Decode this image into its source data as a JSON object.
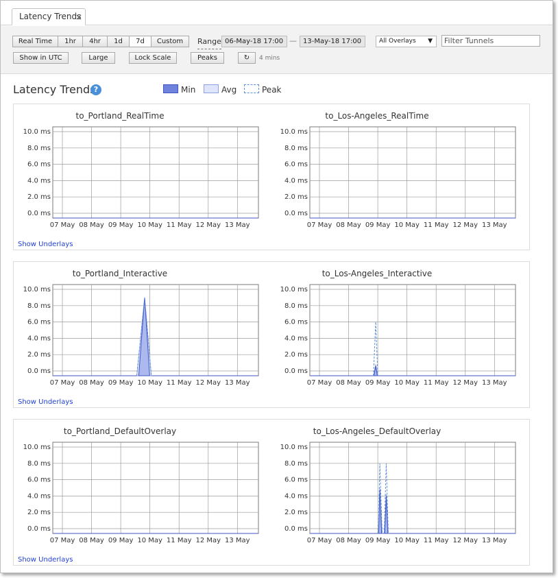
{
  "tab": {
    "label": "Latency Trends",
    "close_glyph": "×"
  },
  "toolbar": {
    "ranges": [
      "Real Time",
      "1hr",
      "4hr",
      "1d",
      "7d",
      "Custom"
    ],
    "active_range": "7d",
    "range_label": "Range",
    "range_start": "06-May-18 17:00",
    "range_separator": "—",
    "range_end": "13-May-18 17:00",
    "overlay_select": "All Overlays",
    "filter_placeholder": "Filter Tunnels",
    "show_utc": "Show in UTC",
    "large": "Large",
    "lock_scale": "Lock Scale",
    "peaks": "Peaks",
    "refresh_glyph": "↻",
    "refresh_interval": "4 mins"
  },
  "page": {
    "title": "Latency Trends",
    "help_glyph": "?",
    "legend": [
      "Min",
      "Avg",
      "Peak"
    ]
  },
  "colors": {
    "min_fill": "#6f83dd",
    "avg_fill": "#dfe6fb",
    "peak_line": "#5b8fd6",
    "link": "#2140d6"
  },
  "panels": [
    {
      "underlays_link": "Show Underlays",
      "charts": [
        {
          "title": "to_Portland_RealTime",
          "spikes": []
        },
        {
          "title": "to_Los-Angeles_RealTime",
          "spikes": []
        }
      ]
    },
    {
      "underlays_link": "Show Underlays",
      "charts": [
        {
          "title": "to_Portland_Interactive",
          "spikes": [
            {
              "start": 2.55,
              "peak_at": 2.82,
              "end": 3.05,
              "min": 9.0,
              "avg": 9.0,
              "peak": 9.0
            }
          ]
        },
        {
          "title": "to_Los-Angeles_Interactive",
          "spikes": [
            {
              "start": 1.85,
              "peak_at": 1.93,
              "end": 2.0,
              "min": 0.6,
              "avg": 0.8,
              "peak": 6.0
            }
          ]
        }
      ]
    },
    {
      "underlays_link": "Show Underlays",
      "charts": [
        {
          "title": "to_Portland_DefaultOverlay",
          "spikes": []
        },
        {
          "title": "to_Los-Angeles_DefaultOverlay",
          "spikes": [
            {
              "start": 2.02,
              "peak_at": 2.07,
              "end": 2.15,
              "min": 4.8,
              "avg": 5.0,
              "peak": 8.0
            },
            {
              "start": 2.22,
              "peak_at": 2.29,
              "end": 2.36,
              "min": 4.0,
              "avg": 4.2,
              "peak": 8.0
            }
          ]
        }
      ]
    }
  ],
  "chart_data": {
    "type": "area",
    "ylabel_unit": "ms",
    "y_ticks": [
      "10.0 ms",
      "8.0 ms",
      "6.0 ms",
      "4.0 ms",
      "2.0 ms",
      "0.0 ms"
    ],
    "ylim": [
      0,
      10
    ],
    "x_ticks": [
      "07 May",
      "08 May",
      "09 May",
      "10 May",
      "11 May",
      "12 May",
      "13 May"
    ],
    "series_names": [
      "Min",
      "Avg",
      "Peak"
    ],
    "grid": true,
    "note": "x positions in spikes are fractional day index (0 = 07 May)"
  }
}
